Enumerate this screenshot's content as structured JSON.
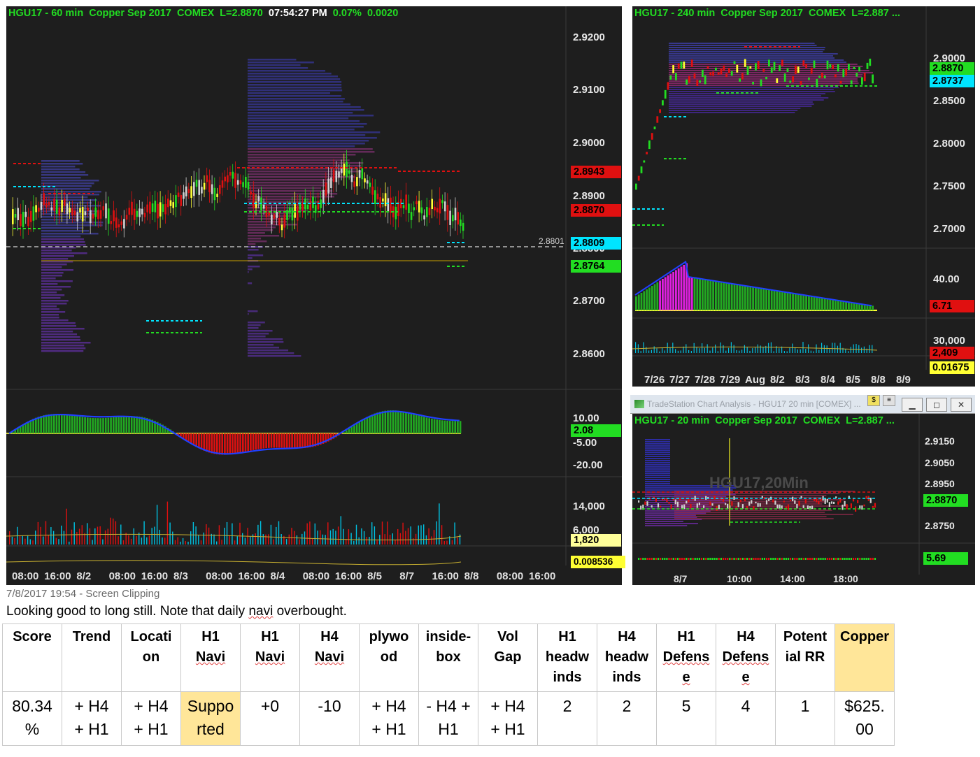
{
  "main_chart": {
    "title_left": "HGU17 - 60 min  Copper Sep 2017  COMEX  L=2.8870  ",
    "title_time": "07:54:27 PM",
    "title_right": "  0.07%  0.0020",
    "price_axis": [
      "2.9200",
      "2.9100",
      "2.9000",
      "2.8900",
      "2.8800",
      "2.8700",
      "2.8600"
    ],
    "tags": {
      "t1": "2.8943",
      "t2": "2.8870",
      "t3": "2.8809",
      "t4": "2.8764"
    },
    "dash_label": "2.8801",
    "osc_axis": [
      "10.00",
      "-5.00",
      "-20.00"
    ],
    "osc_tag": "2.08",
    "vol_axis": [
      "14,000",
      "6,000"
    ],
    "vol_tag": "1,820",
    "low_tag": "0.008536",
    "time_axis": [
      "08:00",
      "16:00",
      "8/2",
      "08:00",
      "16:00",
      "8/3",
      "08:00",
      "16:00",
      "8/4",
      "08:00",
      "16:00",
      "8/5",
      "8/7",
      "16:00",
      "8/8",
      "08:00",
      "16:00"
    ]
  },
  "h4_chart": {
    "title": "HGU17 - 240 min  Copper Sep 2017  COMEX  L=2.887 ...",
    "price_axis": [
      "2.9000",
      "2.8500",
      "2.8000",
      "2.7500",
      "2.7000"
    ],
    "tags": {
      "t1": "2.8870",
      "t2": "2.8737"
    },
    "osc_axis": [
      "40.00"
    ],
    "osc_tag": "6.71",
    "vol_axis": [
      "30,000"
    ],
    "vol_tag": "2,409",
    "low_tag": "0.01675",
    "time_axis": [
      "7/26",
      "7/27",
      "7/28",
      "7/29",
      "Aug",
      "8/2",
      "8/3",
      "8/4",
      "8/5",
      "8/8",
      "8/9"
    ]
  },
  "m20_window": {
    "window_title": "TradeStation Chart Analysis - HGU17 20 min [COMEX] ...",
    "title": "HGU17 - 20 min  Copper Sep 2017  COMEX  L=2.887 ...",
    "watermark": "HGU17,20Min",
    "price_axis": [
      "2.9150",
      "2.9050",
      "2.8950",
      "2.8750"
    ],
    "tags": {
      "t1": "2.8870"
    },
    "osc_tag": "5.69",
    "time_axis": [
      "8/7",
      "10:00",
      "14:00",
      "18:00"
    ]
  },
  "note": {
    "clipping": "7/8/2017 19:54 - Screen Clipping",
    "text_before": "Looking good to long still. Note that daily ",
    "text_navi": "navi",
    "text_after": " overbought."
  },
  "table": {
    "headers": [
      [
        "Score"
      ],
      [
        "Trend"
      ],
      [
        "Locati",
        "on"
      ],
      [
        "H1",
        "Navi"
      ],
      [
        "H1",
        "Navi"
      ],
      [
        "H4",
        "Navi"
      ],
      [
        "plywo",
        "od"
      ],
      [
        "inside-",
        "box"
      ],
      [
        "Vol",
        "Gap"
      ],
      [
        "H1",
        "headw",
        "inds"
      ],
      [
        "H4",
        "headw",
        "inds"
      ],
      [
        "H1",
        "Defens",
        "e"
      ],
      [
        "H4",
        "Defens",
        "e"
      ],
      [
        "Potent",
        "ial RR"
      ],
      [
        "Copper"
      ]
    ],
    "values": [
      [
        "80.34",
        "%"
      ],
      [
        "+ H4",
        "+ H1"
      ],
      [
        "+ H4",
        "+ H1"
      ],
      [
        "Suppo",
        "rted"
      ],
      [
        "+0"
      ],
      [
        "-10"
      ],
      [
        "+ H4",
        "+ H1"
      ],
      [
        "- H4 +",
        "H1"
      ],
      [
        "+ H4",
        "+ H1"
      ],
      [
        "2"
      ],
      [
        "2"
      ],
      [
        "5"
      ],
      [
        "4"
      ],
      [
        "1"
      ],
      [
        "$625.",
        "00"
      ]
    ]
  },
  "colors": {
    "chart_bg": "#1e1e1e",
    "title_green": "#22dd22",
    "tag_red": "#e01010",
    "tag_green": "#22dd22",
    "tag_cyan": "#00e5ff",
    "tag_yellow": "#ffff33",
    "highlight": "#ffe699"
  }
}
